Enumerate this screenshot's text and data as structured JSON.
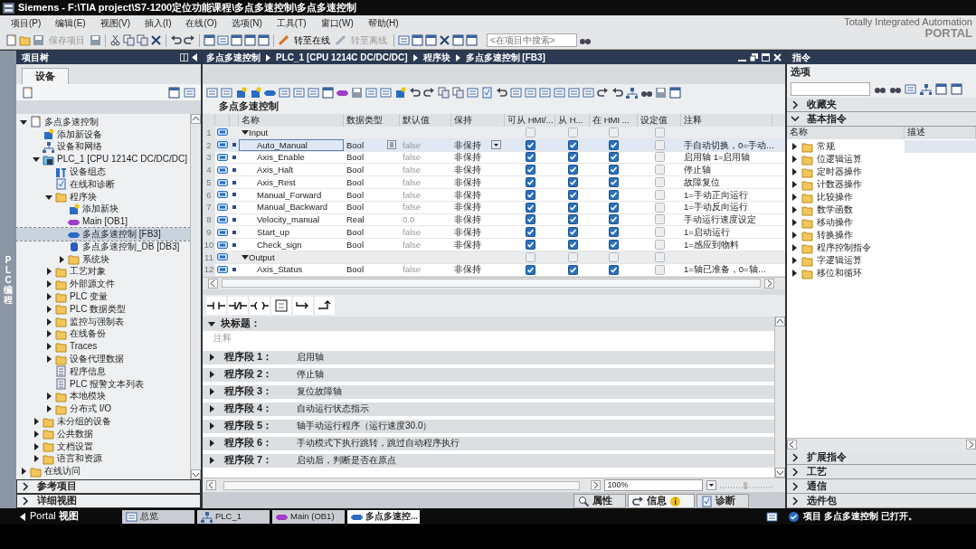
{
  "window": {
    "title": "Siemens  -  F:\\TIA project\\S7-1200定位功能课程\\多点多速控制\\多点多速控制"
  },
  "menu": [
    "项目(P)",
    "编辑(E)",
    "视图(V)",
    "插入(I)",
    "在线(O)",
    "选项(N)",
    "工具(T)",
    "窗口(W)",
    "帮助(H)"
  ],
  "toolbar_buttons": [
    {
      "label": "保存项目",
      "disabled": true
    },
    {
      "label": "转至在线",
      "disabled": false
    },
    {
      "label": "转至离线",
      "disabled": true
    }
  ],
  "search": {
    "placeholder": "<在项目中搜索>"
  },
  "brand": {
    "line1": "Totally Integrated Automation",
    "line2": "PORTAL"
  },
  "project_tree": {
    "title": "项目树",
    "tab": "设备",
    "side_label": "PLC 编程",
    "items": [
      {
        "label": "多点多速控制",
        "kind": "project",
        "expanded": true,
        "selected": false,
        "children": [
          {
            "label": "添加新设备",
            "kind": "add",
            "selected": false
          },
          {
            "label": "设备和网络",
            "kind": "network",
            "selected": false
          },
          {
            "label": "PLC_1 [CPU 1214C DC/DC/DC]",
            "kind": "plc",
            "expanded": true,
            "selected": false,
            "children": [
              {
                "label": "设备组态",
                "kind": "config",
                "selected": false
              },
              {
                "label": "在线和诊断",
                "kind": "diag",
                "selected": false
              },
              {
                "label": "程序块",
                "kind": "folder",
                "expanded": true,
                "selected": false,
                "children": [
                  {
                    "label": "添加新块",
                    "kind": "add",
                    "selected": false
                  },
                  {
                    "label": "Main [OB1]",
                    "kind": "ob",
                    "selected": false
                  },
                  {
                    "label": "多点多速控制 [FB3]",
                    "kind": "fb",
                    "selected": true
                  },
                  {
                    "label": "多点多速控制_DB [DB3]",
                    "kind": "db",
                    "selected": false
                  },
                  {
                    "label": "系统块",
                    "kind": "folder",
                    "expanded": false,
                    "selected": false
                  }
                ]
              },
              {
                "label": "工艺对象",
                "kind": "folder",
                "expanded": false,
                "selected": false
              },
              {
                "label": "外部源文件",
                "kind": "folder",
                "expanded": false,
                "selected": false
              },
              {
                "label": "PLC 变量",
                "kind": "folder",
                "expanded": false,
                "selected": false
              },
              {
                "label": "PLC 数据类型",
                "kind": "folder",
                "expanded": false,
                "selected": false
              },
              {
                "label": "监控与强制表",
                "kind": "folder",
                "expanded": false,
                "selected": false
              },
              {
                "label": "在线备份",
                "kind": "folder",
                "expanded": false,
                "selected": false
              },
              {
                "label": "Traces",
                "kind": "folder",
                "expanded": false,
                "selected": false
              },
              {
                "label": "设备代理数据",
                "kind": "folder",
                "expanded": false,
                "selected": false
              },
              {
                "label": "程序信息",
                "kind": "doc",
                "selected": false
              },
              {
                "label": "PLC 报警文本列表",
                "kind": "doc",
                "selected": false
              },
              {
                "label": "本地模块",
                "kind": "folder",
                "expanded": false,
                "selected": false
              },
              {
                "label": "分布式 I/O",
                "kind": "folder",
                "expanded": false,
                "selected": false
              }
            ]
          },
          {
            "label": "未分组的设备",
            "kind": "folder",
            "expanded": false,
            "selected": false
          },
          {
            "label": "公共数据",
            "kind": "folder",
            "expanded": false,
            "selected": false
          },
          {
            "label": "文档设置",
            "kind": "folder",
            "expanded": false,
            "selected": false
          },
          {
            "label": "语言和资源",
            "kind": "folder",
            "expanded": false,
            "selected": false
          }
        ]
      },
      {
        "label": "在线访问",
        "kind": "folder",
        "expanded": false,
        "selected": false
      }
    ],
    "sections": [
      "参考项目",
      "详细视图"
    ]
  },
  "editor": {
    "breadcrumb": [
      "多点多速控制",
      "PLC_1 [CPU 1214C DC/DC/DC]",
      "程序块",
      "多点多速控制 [FB3]"
    ],
    "block_name": "多点多速控制",
    "columns": [
      "名称",
      "数据类型",
      "默认值",
      "保持",
      "可从 HMI/...",
      "从 H...",
      "在 HMI ...",
      "设定值",
      "注释"
    ],
    "rows": [
      {
        "kind": "section",
        "index": "1",
        "name": "Input",
        "expanded": true,
        "hmi_accessible": false,
        "hmi_writable": false,
        "hmi_visible": false,
        "setpoint": false
      },
      {
        "kind": "var",
        "index": "2",
        "name": "Auto_Manual",
        "type": "Bool",
        "default": "false",
        "retain": "非保持",
        "hmi_accessible": true,
        "hmi_writable": true,
        "hmi_visible": true,
        "setpoint": false,
        "comment": "手自动切换，0=手动…",
        "selected": true
      },
      {
        "kind": "var",
        "index": "3",
        "name": "Axis_Enable",
        "type": "Bool",
        "default": "false",
        "retain": "非保持",
        "hmi_accessible": true,
        "hmi_writable": true,
        "hmi_visible": true,
        "setpoint": false,
        "comment": "启用轴 1=启用轴",
        "selected": false
      },
      {
        "kind": "var",
        "index": "4",
        "name": "Axis_Halt",
        "type": "Bool",
        "default": "false",
        "retain": "非保持",
        "hmi_accessible": true,
        "hmi_writable": true,
        "hmi_visible": true,
        "setpoint": false,
        "comment": "停止轴",
        "selected": false
      },
      {
        "kind": "var",
        "index": "5",
        "name": "Axis_Rest",
        "type": "Bool",
        "default": "false",
        "retain": "非保持",
        "hmi_accessible": true,
        "hmi_writable": true,
        "hmi_visible": true,
        "setpoint": false,
        "comment": "故障复位",
        "selected": false
      },
      {
        "kind": "var",
        "index": "6",
        "name": "Manual_Forward",
        "type": "Bool",
        "default": "false",
        "retain": "非保持",
        "hmi_accessible": true,
        "hmi_writable": true,
        "hmi_visible": true,
        "setpoint": false,
        "comment": "1=手动正向运行",
        "selected": false
      },
      {
        "kind": "var",
        "index": "7",
        "name": "Manual_Backward",
        "type": "Bool",
        "default": "false",
        "retain": "非保持",
        "hmi_accessible": true,
        "hmi_writable": true,
        "hmi_visible": true,
        "setpoint": false,
        "comment": "1=手动反向运行",
        "selected": false
      },
      {
        "kind": "var",
        "index": "8",
        "name": "Velocity_manual",
        "type": "Real",
        "default": "0.0",
        "retain": "非保持",
        "hmi_accessible": true,
        "hmi_writable": true,
        "hmi_visible": true,
        "setpoint": false,
        "comment": "手动运行速度设定",
        "selected": false
      },
      {
        "kind": "var",
        "index": "9",
        "name": "Start_up",
        "type": "Bool",
        "default": "false",
        "retain": "非保持",
        "hmi_accessible": true,
        "hmi_writable": true,
        "hmi_visible": true,
        "setpoint": false,
        "comment": "1=启动运行",
        "selected": false
      },
      {
        "kind": "var",
        "index": "10",
        "name": "Check_sign",
        "type": "Bool",
        "default": "false",
        "retain": "非保持",
        "hmi_accessible": true,
        "hmi_writable": true,
        "hmi_visible": true,
        "setpoint": false,
        "comment": "1=感应到物料",
        "selected": false
      },
      {
        "kind": "section",
        "index": "11",
        "name": "Output",
        "expanded": true,
        "hmi_accessible": false,
        "hmi_writable": false,
        "hmi_visible": false,
        "setpoint": false
      },
      {
        "kind": "var",
        "index": "12",
        "name": "Axis_Status",
        "type": "Bool",
        "default": "false",
        "retain": "非保持",
        "hmi_accessible": true,
        "hmi_writable": true,
        "hmi_visible": true,
        "setpoint": false,
        "comment": "1=轴已准备，0=轴…",
        "selected": false
      }
    ],
    "block_title": {
      "label": "块标题：",
      "expanded": true,
      "comment": "注释"
    },
    "networks": [
      {
        "label": "程序段 1：",
        "comment": "启用轴",
        "expanded": false
      },
      {
        "label": "程序段 2：",
        "comment": "停止轴",
        "expanded": false
      },
      {
        "label": "程序段 3：",
        "comment": "复位故障轴",
        "expanded": false
      },
      {
        "label": "程序段 4：",
        "comment": "自动运行状态指示",
        "expanded": false
      },
      {
        "label": "程序段 5：",
        "comment": "轴手动运行程序（运行速度30.0）",
        "expanded": false
      },
      {
        "label": "程序段 6：",
        "comment": "手动模式下执行跳转，跳过自动程序执行",
        "expanded": false
      },
      {
        "label": "程序段 7：",
        "comment": "启动后，判断是否在原点",
        "expanded": false
      }
    ],
    "zoom": "100%"
  },
  "inspector_tabs": [
    {
      "label": "属性",
      "selected": false
    },
    {
      "label": "信息",
      "selected": true
    },
    {
      "label": "诊断",
      "selected": false
    }
  ],
  "instructions": {
    "title": "指令",
    "options": "选项",
    "sections_top": [
      {
        "label": "收藏夹",
        "expanded": false
      },
      {
        "label": "基本指令",
        "expanded": true
      }
    ],
    "columns": [
      "名称",
      "描述"
    ],
    "items": [
      {
        "label": "常规",
        "selected": true
      },
      {
        "label": "位逻辑运算",
        "selected": false
      },
      {
        "label": "定时器操作",
        "selected": false
      },
      {
        "label": "计数器操作",
        "selected": false
      },
      {
        "label": "比较操作",
        "selected": false
      },
      {
        "label": "数学函数",
        "selected": false
      },
      {
        "label": "移动操作",
        "selected": false
      },
      {
        "label": "转换操作",
        "selected": false
      },
      {
        "label": "程序控制指令",
        "selected": false
      },
      {
        "label": "字逻辑运算",
        "selected": false
      },
      {
        "label": "移位和循环",
        "selected": false
      }
    ],
    "sections_bottom": [
      {
        "label": "扩展指令",
        "expanded": false
      },
      {
        "label": "工艺",
        "expanded": false
      },
      {
        "label": "通信",
        "expanded": false
      },
      {
        "label": "选件包",
        "expanded": false
      }
    ]
  },
  "taskbar": {
    "portal": "Portal **视图**",
    "tabs": [
      {
        "label": "总览",
        "kind": "overview",
        "selected": false
      },
      {
        "label": "PLC_1",
        "kind": "device",
        "selected": false
      },
      {
        "label": "Main (OB1)",
        "kind": "ob",
        "selected": false
      },
      {
        "label": "多点多速控...",
        "kind": "fb",
        "selected": true
      }
    ],
    "status": "项目 多点多速控制 已打开。"
  }
}
